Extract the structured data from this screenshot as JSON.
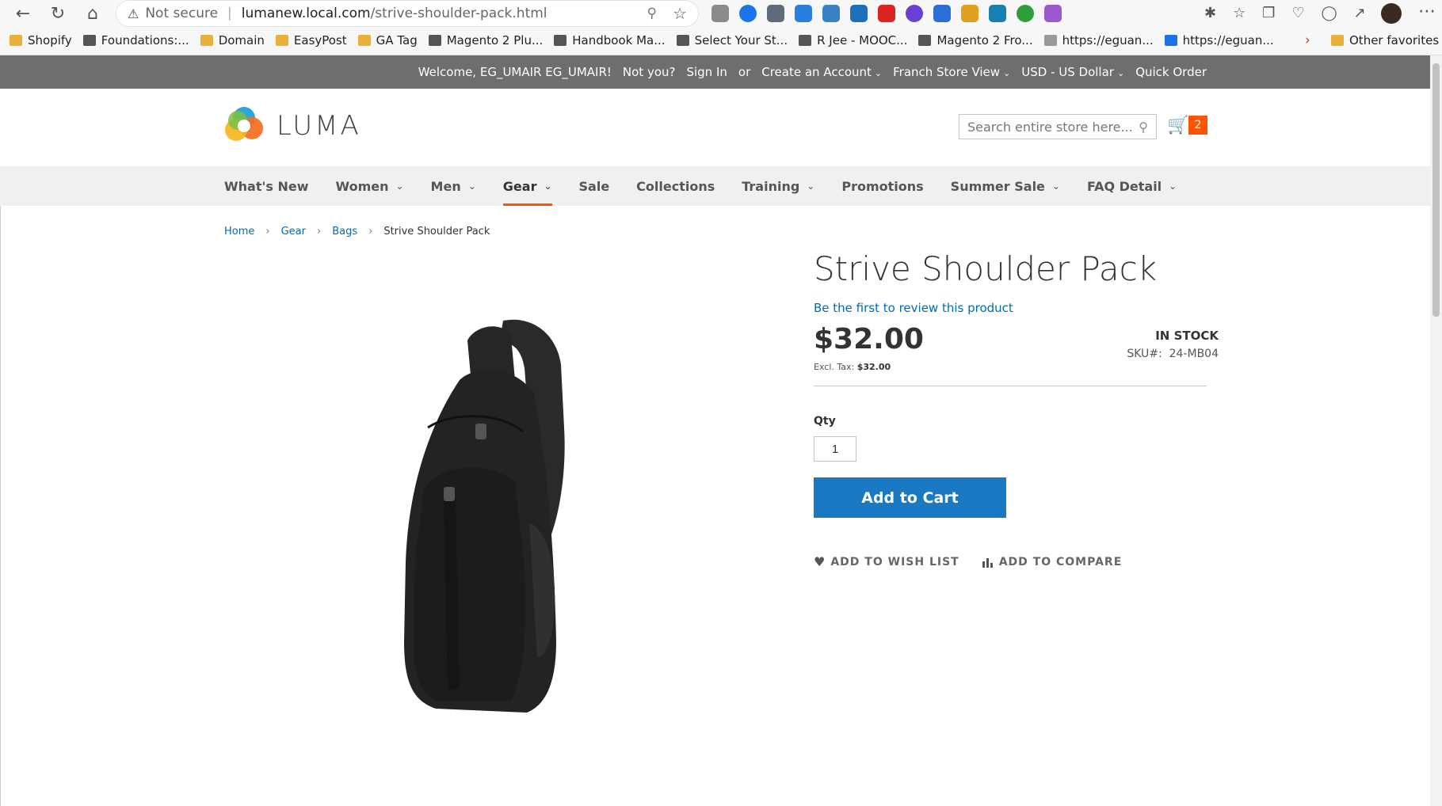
{
  "browser": {
    "security_label": "Not secure",
    "url_host": "lumanew.local.com",
    "url_path": "/strive-shoulder-pack.html",
    "bookmarks": [
      {
        "label": "Shopify",
        "icon": "folder-icon"
      },
      {
        "label": "Foundations:...",
        "icon": "bookmark-favicon"
      },
      {
        "label": "Domain",
        "icon": "folder-icon"
      },
      {
        "label": "EasyPost",
        "icon": "folder-icon"
      },
      {
        "label": "GA Tag",
        "icon": "folder-icon"
      },
      {
        "label": "Magento 2 Plu...",
        "icon": "bookmark-favicon"
      },
      {
        "label": "Handbook Ma...",
        "icon": "bookmark-favicon"
      },
      {
        "label": "Select Your St...",
        "icon": "bookmark-favicon"
      },
      {
        "label": "R Jee - MOOC...",
        "icon": "bookmark-favicon"
      },
      {
        "label": "Magento 2 Fro...",
        "icon": "bookmark-favicon"
      },
      {
        "label": "https://eguan...",
        "icon": "page-icon"
      },
      {
        "label": "https://eguan...",
        "icon": "cloud-icon"
      }
    ],
    "other_favorites": "Other favorites"
  },
  "panel": {
    "welcome": "Welcome, EG_UMAIR EG_UMAIR!",
    "not_you": "Not you?",
    "sign_in": "Sign In",
    "or": "or",
    "create_account": "Create an Account",
    "store_view": "Franch Store View",
    "currency": "USD - US Dollar",
    "quick_order": "Quick Order"
  },
  "header": {
    "logo_text": "LUMA",
    "search_placeholder": "Search entire store here...",
    "cart_count": "2"
  },
  "nav": [
    {
      "label": "What's New",
      "dropdown": false
    },
    {
      "label": "Women",
      "dropdown": true
    },
    {
      "label": "Men",
      "dropdown": true
    },
    {
      "label": "Gear",
      "dropdown": true,
      "active": true
    },
    {
      "label": "Sale",
      "dropdown": false
    },
    {
      "label": "Collections",
      "dropdown": false
    },
    {
      "label": "Training",
      "dropdown": true
    },
    {
      "label": "Promotions",
      "dropdown": false
    },
    {
      "label": "Summer Sale",
      "dropdown": true
    },
    {
      "label": "FAQ Detail",
      "dropdown": true
    }
  ],
  "breadcrumbs": {
    "home": "Home",
    "gear": "Gear",
    "bags": "Bags",
    "current": "Strive Shoulder Pack"
  },
  "product": {
    "title": "Strive Shoulder Pack",
    "review_link": "Be the first to review this product",
    "price": "$32.00",
    "excl_tax_label": "Excl. Tax:",
    "excl_tax_value": "$32.00",
    "stock": "IN STOCK",
    "sku_label": "SKU#:",
    "sku_value": "24-MB04",
    "qty_label": "Qty",
    "qty_value": "1",
    "add_to_cart": "Add to Cart",
    "wishlist": "ADD TO WISH LIST",
    "compare": "ADD TO COMPARE"
  },
  "colors": {
    "accent": "#ff5501",
    "primary_button": "#1979c3",
    "link": "#006bb4",
    "panel_bg": "#6e6e6c"
  }
}
